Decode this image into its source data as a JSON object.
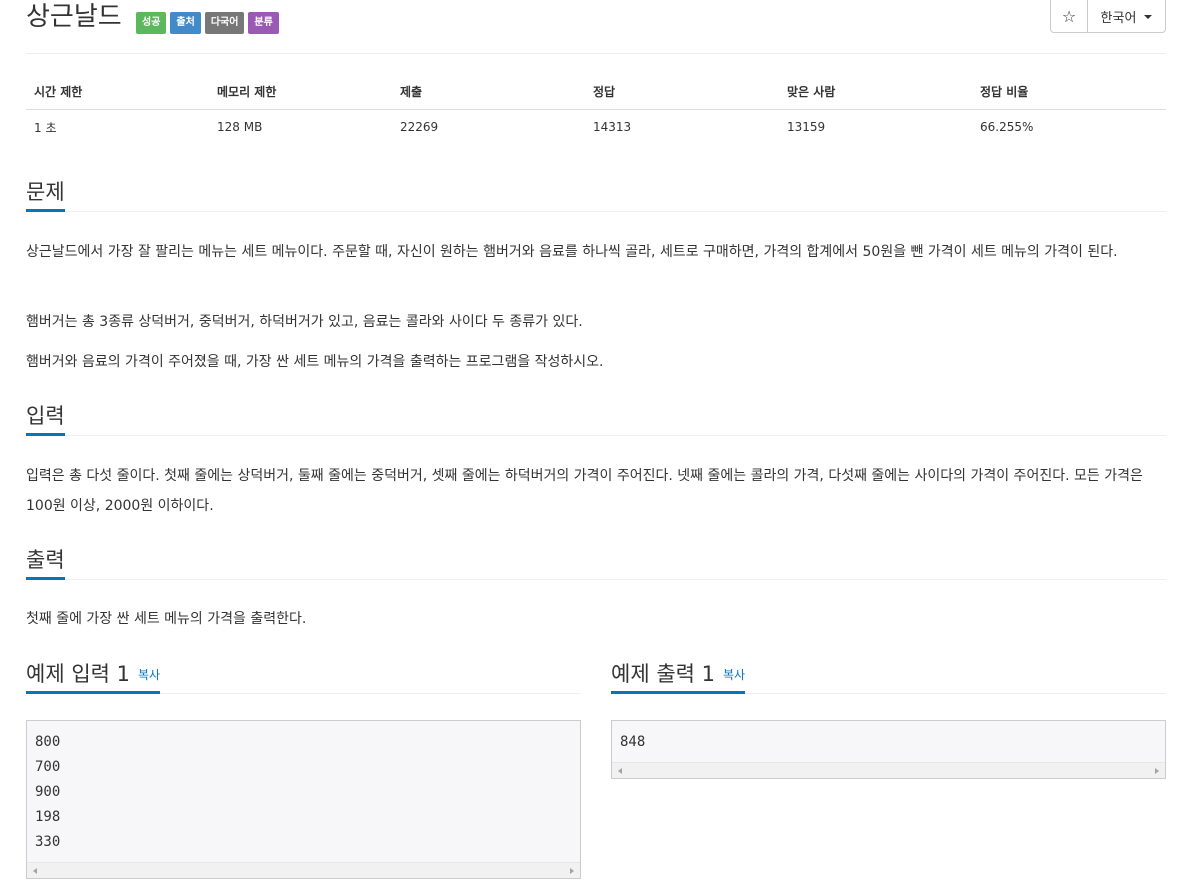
{
  "problem": {
    "title": "상근날드",
    "labels": {
      "success": "성공",
      "source": "출처",
      "multilang": "다국어",
      "category": "분류"
    }
  },
  "controls": {
    "star_icon": "star-outline-icon",
    "star_glyph": "☆",
    "language": "한국어"
  },
  "info_table": {
    "headers": [
      "시간 제한",
      "메모리 제한",
      "제출",
      "정답",
      "맞은 사람",
      "정답 비율"
    ],
    "values": [
      "1 초",
      "128 MB",
      "22269",
      "14313",
      "13159",
      "66.255%"
    ]
  },
  "sections": {
    "problem_heading": "문제",
    "problem_paragraphs": [
      "상근날드에서 가장 잘 팔리는 메뉴는 세트 메뉴이다. 주문할 때, 자신이 원하는 햄버거와 음료를 하나씩 골라, 세트로 구매하면, 가격의 합계에서 50원을 뺀 가격이 세트 메뉴의 가격이 된다.",
      "햄버거는 총 3종류 상덕버거, 중덕버거, 하덕버거가 있고, 음료는 콜라와 사이다 두 종류가 있다.",
      "햄버거와 음료의 가격이 주어졌을 때, 가장 싼 세트 메뉴의 가격을 출력하는 프로그램을 작성하시오."
    ],
    "input_heading": "입력",
    "input_text": "입력은 총 다섯 줄이다. 첫째 줄에는 상덕버거, 둘째 줄에는 중덕버거, 셋째 줄에는 하덕버거의 가격이 주어진다. 넷째 줄에는 콜라의 가격, 다섯째 줄에는 사이다의 가격이 주어진다. 모든 가격은 100원 이상, 2000원 이하이다.",
    "output_heading": "출력",
    "output_text": "첫째 줄에 가장 싼 세트 메뉴의 가격을 출력한다."
  },
  "samples": {
    "input_heading": "예제 입력 1",
    "output_heading": "예제 출력 1",
    "copy_label": "복사",
    "input_text": "800\n700\n900\n198\n330",
    "output_text": "848"
  }
}
